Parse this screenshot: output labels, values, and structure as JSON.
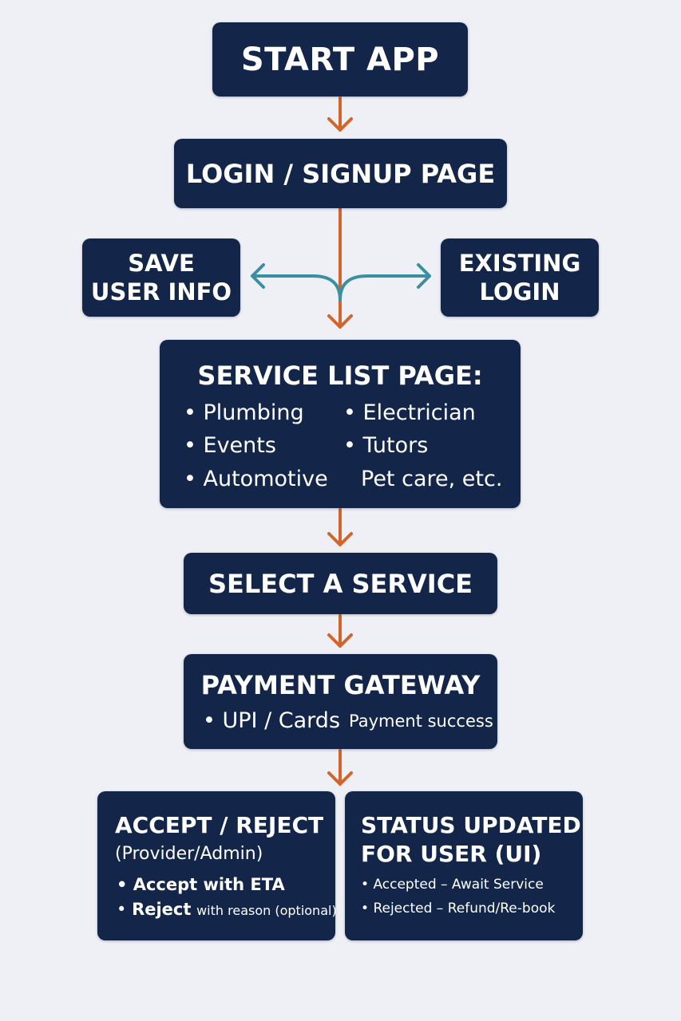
{
  "colors": {
    "background": "#eef0f5",
    "box": "#13264a",
    "text": "#ffffff",
    "main_arrow": "#d2652c",
    "branch_arrow": "#3b8fa0"
  },
  "nodes": {
    "start": {
      "title": "START APP"
    },
    "login": {
      "title": "LOGIN / SIGNUP PAGE"
    },
    "save_user": {
      "line1": "SAVE",
      "line2": "USER INFO"
    },
    "existing_login": {
      "line1": "EXISTING",
      "line2": "LOGIN"
    },
    "service_list": {
      "title": "SERVICE LIST PAGE:",
      "items": [
        "Plumbing",
        "Electrician",
        "Events",
        "Tutors",
        "Automotive",
        "Pet care, etc."
      ]
    },
    "select_service": {
      "title": "SELECT A SERVICE"
    },
    "payment": {
      "title": "PAYMENT GATEWAY",
      "item1": "UPI / Cards",
      "item2": "Payment success"
    },
    "accept_reject": {
      "title": "ACCEPT / REJECT",
      "subtitle": "(Provider/Admin)",
      "item1": "Accept with ETA",
      "item2_bold": "Reject",
      "item2_rest": "with reason (optional)"
    },
    "status_update": {
      "line1": "STATUS UPDATED",
      "line2": "FOR USER (UI)",
      "item1": "Accepted – Await Service",
      "item2": "Rejected – Refund/Re-book"
    }
  }
}
